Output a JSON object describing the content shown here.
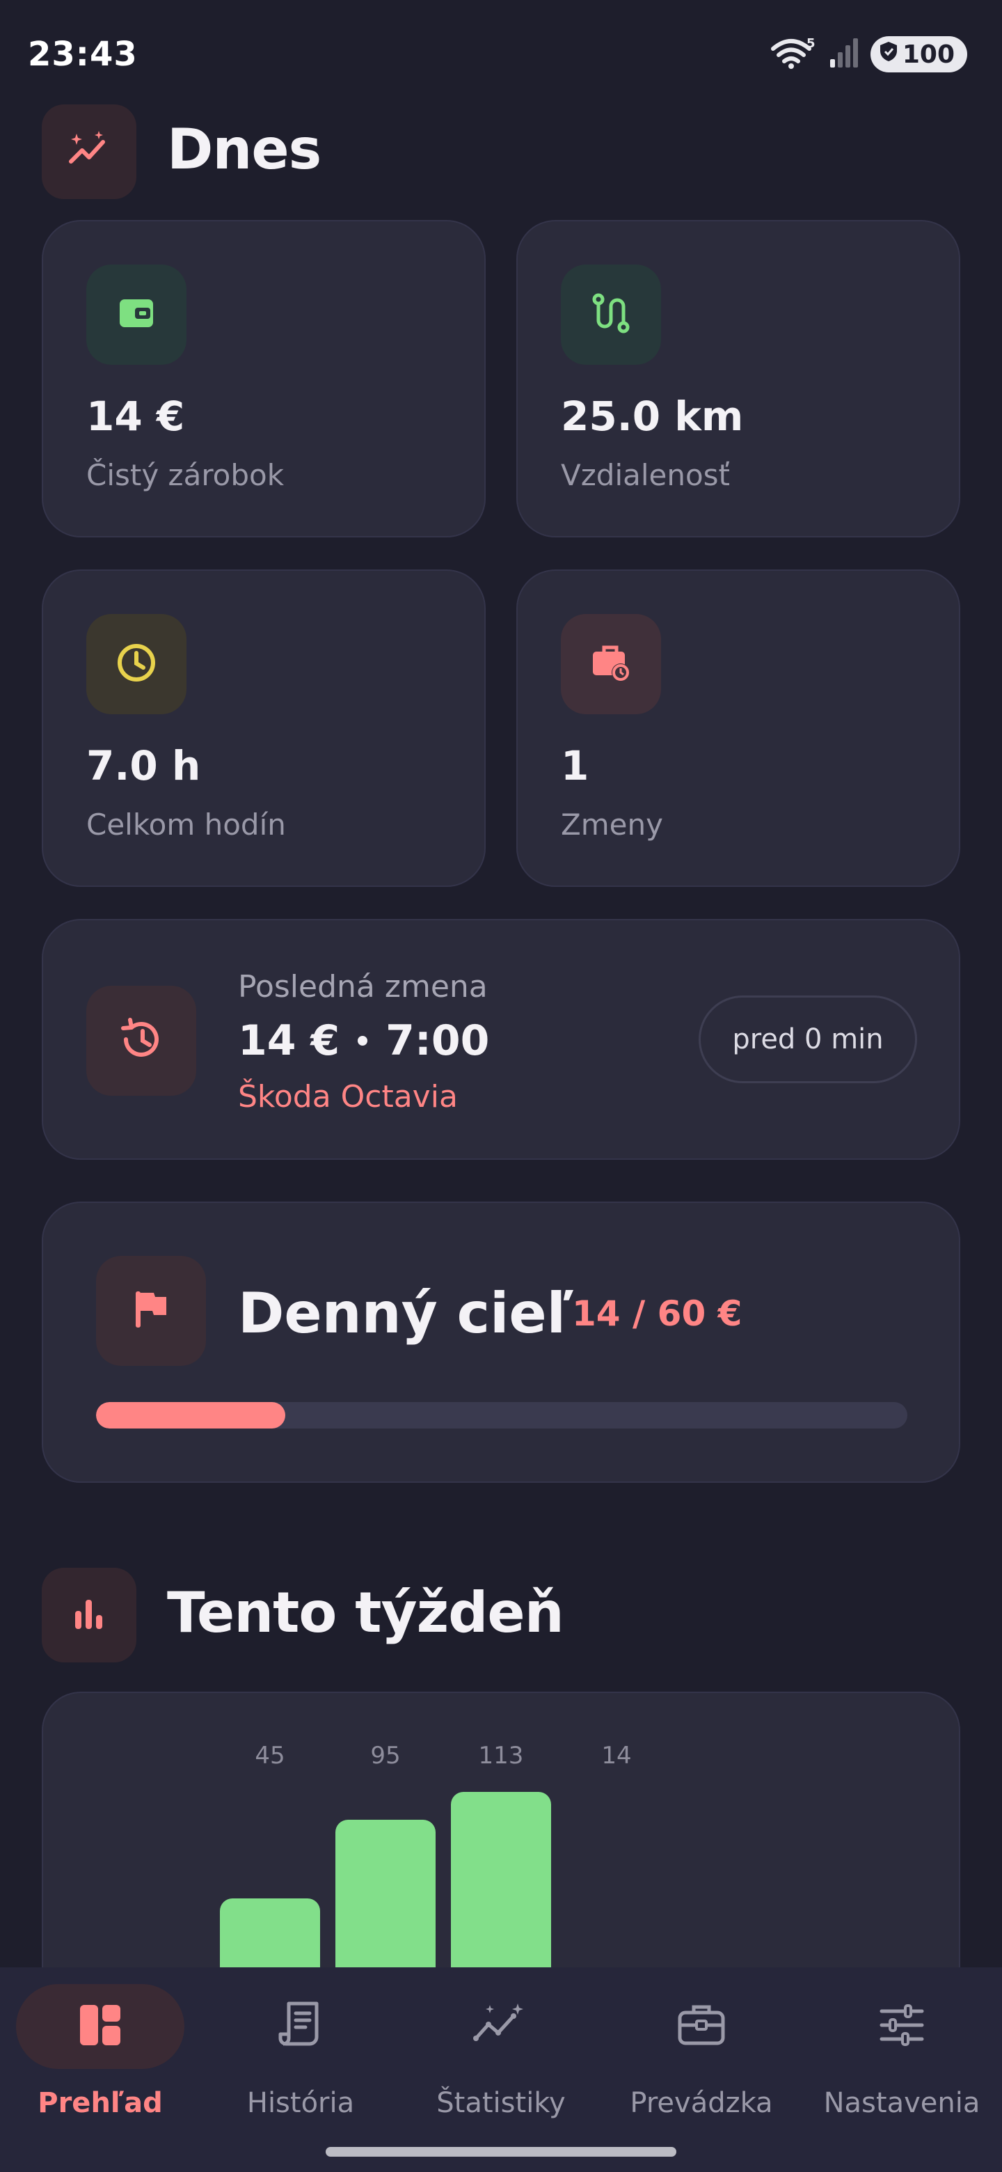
{
  "status_bar": {
    "time": "23:43",
    "wifi_badge": "5",
    "battery": "100"
  },
  "today": {
    "title": "Dnes",
    "tiles": [
      {
        "value": "14 €",
        "label": "Čistý zárobok",
        "icon": "wallet-icon",
        "color": "#7ee081"
      },
      {
        "value": "25.0 km",
        "label": "Vzdialenosť",
        "icon": "route-icon",
        "color": "#7ee081"
      },
      {
        "value": "7.0 h",
        "label": "Celkom hodín",
        "icon": "clock-icon",
        "color": "#e8d24c"
      },
      {
        "value": "1",
        "label": "Zmeny",
        "icon": "briefcase-clock-icon",
        "color": "#ff8585"
      }
    ]
  },
  "last_shift": {
    "label": "Posledná zmena",
    "amount": "14 €",
    "duration": "7:00",
    "vehicle": "Škoda Octavia",
    "ago": "pred 0 min"
  },
  "daily_goal": {
    "title": "Denný cieľ",
    "amount_text": "14 / 60 €",
    "progress": 0.2333
  },
  "week": {
    "title": "Tento týždeň",
    "chart_data": {
      "type": "bar",
      "values": [
        45,
        95,
        113,
        14
      ],
      "value_labels": [
        "45",
        "95",
        "113",
        "14"
      ],
      "color": "#82df8a"
    }
  },
  "nav": {
    "items": [
      {
        "label": "Prehľad",
        "icon": "dashboard-icon",
        "active": true
      },
      {
        "label": "História",
        "icon": "receipt-icon",
        "active": false
      },
      {
        "label": "Štatistiky",
        "icon": "stats-sparkle-icon",
        "active": false
      },
      {
        "label": "Prevádzka",
        "icon": "toolbox-icon",
        "active": false
      },
      {
        "label": "Nastavenia",
        "icon": "sliders-icon",
        "active": false
      }
    ]
  },
  "colors": {
    "accent": "#ff8585",
    "positive": "#82df8a",
    "background": "#1e1e2c",
    "card": "#2b2b3b"
  }
}
